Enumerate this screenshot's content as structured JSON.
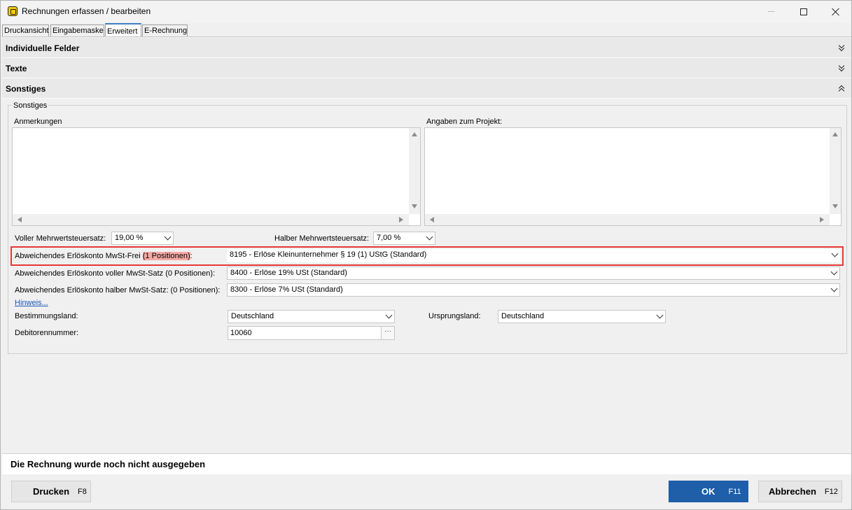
{
  "window": {
    "title": "Rechnungen erfassen / bearbeiten"
  },
  "tabs": [
    {
      "label": "Druckansicht"
    },
    {
      "label": "Eingabemaske"
    },
    {
      "label": "Erweitert",
      "active": true
    },
    {
      "label": "E-Rechnung"
    }
  ],
  "sections": {
    "individuelle": "Individuelle Felder",
    "texte": "Texte",
    "sonstiges": "Sonstiges"
  },
  "group": {
    "legend": "Sonstiges",
    "anmerkungen_label": "Anmerkungen",
    "anmerkungen_value": "",
    "projekt_label": "Angaben zum Projekt:",
    "projekt_value": "",
    "voller_label": "Voller Mehrwertsteuersatz:",
    "voller_value": "19,00 %",
    "halber_label": "Halber Mehrwertsteuersatz:",
    "halber_value": "7,00 %",
    "erloes_frei_label_prefix": "Abweichendes Erlöskonto MwSt-Frei ",
    "erloes_frei_positions": "(1 Positionen)",
    "erloes_frei_colon": ":",
    "erloes_frei_value": "8195 - Erlöse Kleinunternehmer § 19 (1) UStG (Standard)",
    "erloes_voll_label": "Abweichendes Erlöskonto voller MwSt-Satz (0 Positionen):",
    "erloes_voll_value": "8400 - Erlöse 19% USt (Standard)",
    "erloes_halb_label": "Abweichendes Erlöskonto halber MwSt-Satz: (0 Positionen):",
    "erloes_halb_value": "8300 - Erlöse 7% USt (Standard)",
    "hinweis": "Hinweis...",
    "bestimmungsland_label": "Bestimmungsland:",
    "bestimmungsland_value": "Deutschland",
    "ursprungsland_label": "Ursprungsland:",
    "ursprungsland_value": "Deutschland",
    "debitor_label": "Debitorennummer:",
    "debitor_value": "10060",
    "ellipsis": "···"
  },
  "status": {
    "text": "Die Rechnung wurde noch nicht ausgegeben"
  },
  "buttons": {
    "drucken": "Drucken",
    "drucken_key": "F8",
    "ok": "OK",
    "ok_key": "F11",
    "abbrechen": "Abbrechen",
    "abbrechen_key": "F12"
  },
  "colors": {
    "accent": "#1f5ea8",
    "highlight_border": "#e53935",
    "highlight_fill": "#f4a9a5",
    "link": "#1a57b5"
  }
}
